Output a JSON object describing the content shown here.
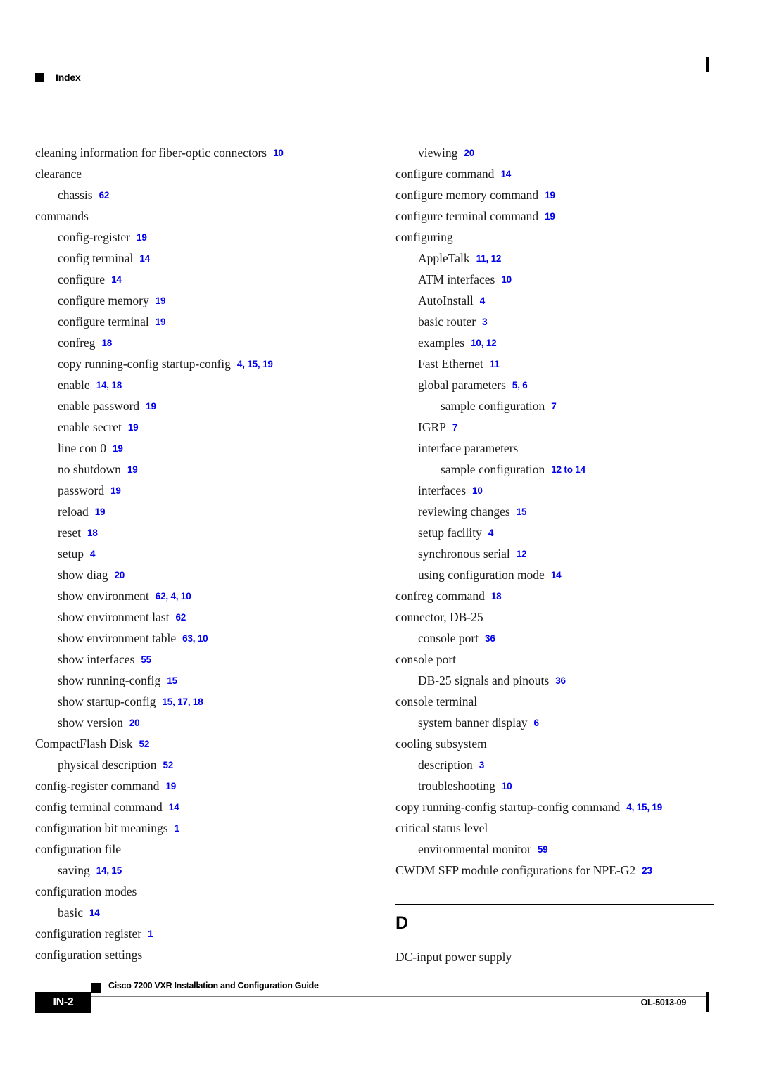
{
  "header": {
    "label": "Index",
    "marker_icon": "filled-square-icon"
  },
  "footer": {
    "page_number": "IN-2",
    "document_title": "Cisco 7200 VXR Installation and Configuration Guide",
    "document_id": "OL-5013-09",
    "marker_icon": "filled-square-icon"
  },
  "colors": {
    "page_number_link": "#0000ee",
    "text": "#1a1a1a",
    "rule": "#000000",
    "footer_rule": "#808080"
  },
  "columns": {
    "left": [
      {
        "level": 0,
        "term": "cleaning information for fiber-optic connectors",
        "pages": "10"
      },
      {
        "level": 0,
        "term": "clearance",
        "pages": ""
      },
      {
        "level": 1,
        "term": "chassis",
        "pages": "62"
      },
      {
        "level": 0,
        "term": "commands",
        "pages": ""
      },
      {
        "level": 1,
        "term": "config-register",
        "pages": "19"
      },
      {
        "level": 1,
        "term": "config terminal",
        "pages": "14"
      },
      {
        "level": 1,
        "term": "configure",
        "pages": "14"
      },
      {
        "level": 1,
        "term": "configure memory",
        "pages": "19"
      },
      {
        "level": 1,
        "term": "configure terminal",
        "pages": "19"
      },
      {
        "level": 1,
        "term": "confreg",
        "pages": "18"
      },
      {
        "level": 1,
        "term": "copy running-config startup-config",
        "pages": "4, 15, 19"
      },
      {
        "level": 1,
        "term": "enable",
        "pages": "14, 18"
      },
      {
        "level": 1,
        "term": "enable password",
        "pages": "19"
      },
      {
        "level": 1,
        "term": "enable secret",
        "pages": "19"
      },
      {
        "level": 1,
        "term": "line con 0",
        "pages": "19"
      },
      {
        "level": 1,
        "term": "no shutdown",
        "pages": "19"
      },
      {
        "level": 1,
        "term": "password",
        "pages": "19"
      },
      {
        "level": 1,
        "term": "reload",
        "pages": "19"
      },
      {
        "level": 1,
        "term": "reset",
        "pages": "18"
      },
      {
        "level": 1,
        "term": "setup",
        "pages": "4"
      },
      {
        "level": 1,
        "term": "show diag",
        "pages": "20"
      },
      {
        "level": 1,
        "term": "show environment",
        "pages": "62, 4, 10"
      },
      {
        "level": 1,
        "term": "show environment last",
        "pages": "62"
      },
      {
        "level": 1,
        "term": "show environment table",
        "pages": "63, 10"
      },
      {
        "level": 1,
        "term": "show interfaces",
        "pages": "55"
      },
      {
        "level": 1,
        "term": "show running-config",
        "pages": "15"
      },
      {
        "level": 1,
        "term": "show startup-config",
        "pages": "15, 17, 18"
      },
      {
        "level": 1,
        "term": "show version",
        "pages": "20"
      },
      {
        "level": 0,
        "term": "CompactFlash Disk",
        "pages": "52"
      },
      {
        "level": 1,
        "term": "physical description",
        "pages": "52"
      },
      {
        "level": 0,
        "term": "config-register command",
        "pages": "19"
      },
      {
        "level": 0,
        "term": "config terminal command",
        "pages": "14"
      },
      {
        "level": 0,
        "term": "configuration bit meanings",
        "pages": "1"
      },
      {
        "level": 0,
        "term": "configuration file",
        "pages": ""
      },
      {
        "level": 1,
        "term": "saving",
        "pages": "14, 15"
      },
      {
        "level": 0,
        "term": "configuration modes",
        "pages": ""
      },
      {
        "level": 1,
        "term": "basic",
        "pages": "14"
      },
      {
        "level": 0,
        "term": "configuration register",
        "pages": "1"
      },
      {
        "level": 0,
        "term": "configuration settings",
        "pages": ""
      }
    ],
    "right": [
      {
        "level": 1,
        "term": "viewing",
        "pages": "20"
      },
      {
        "level": 0,
        "term": "configure command",
        "pages": "14"
      },
      {
        "level": 0,
        "term": "configure memory command",
        "pages": "19"
      },
      {
        "level": 0,
        "term": "configure terminal command",
        "pages": "19"
      },
      {
        "level": 0,
        "term": "configuring",
        "pages": ""
      },
      {
        "level": 1,
        "term": "AppleTalk",
        "pages": "11, 12"
      },
      {
        "level": 1,
        "term": "ATM interfaces",
        "pages": "10"
      },
      {
        "level": 1,
        "term": "AutoInstall",
        "pages": "4"
      },
      {
        "level": 1,
        "term": "basic router",
        "pages": "3"
      },
      {
        "level": 1,
        "term": "examples",
        "pages": "10, 12"
      },
      {
        "level": 1,
        "term": "Fast Ethernet",
        "pages": "11"
      },
      {
        "level": 1,
        "term": "global parameters",
        "pages": "5, 6"
      },
      {
        "level": 2,
        "term": "sample configuration",
        "pages": "7"
      },
      {
        "level": 1,
        "term": "IGRP",
        "pages": "7"
      },
      {
        "level": 1,
        "term": "interface parameters",
        "pages": ""
      },
      {
        "level": 2,
        "term": "sample configuration",
        "pages": "12 to 14"
      },
      {
        "level": 1,
        "term": "interfaces",
        "pages": "10"
      },
      {
        "level": 1,
        "term": "reviewing changes",
        "pages": "15"
      },
      {
        "level": 1,
        "term": "setup facility",
        "pages": "4"
      },
      {
        "level": 1,
        "term": "synchronous serial",
        "pages": "12"
      },
      {
        "level": 1,
        "term": "using configuration mode",
        "pages": "14"
      },
      {
        "level": 0,
        "term": "confreg command",
        "pages": "18"
      },
      {
        "level": 0,
        "term": "connector, DB-25",
        "pages": ""
      },
      {
        "level": 1,
        "term": "console port",
        "pages": "36"
      },
      {
        "level": 0,
        "term": "console port",
        "pages": ""
      },
      {
        "level": 1,
        "term": "DB-25 signals and pinouts",
        "pages": "36"
      },
      {
        "level": 0,
        "term": "console terminal",
        "pages": ""
      },
      {
        "level": 1,
        "term": "system banner display",
        "pages": "6"
      },
      {
        "level": 0,
        "term": "cooling subsystem",
        "pages": ""
      },
      {
        "level": 1,
        "term": "description",
        "pages": "3"
      },
      {
        "level": 1,
        "term": "troubleshooting",
        "pages": "10"
      },
      {
        "level": 0,
        "term": "copy running-config startup-config command",
        "pages": "4, 15, 19"
      },
      {
        "level": 0,
        "term": "critical status level",
        "pages": ""
      },
      {
        "level": 1,
        "term": "environmental monitor",
        "pages": "59"
      },
      {
        "level": 0,
        "term": "CWDM SFP module configurations for NPE-G2",
        "pages": "23"
      },
      {
        "type": "section",
        "letter": "D"
      },
      {
        "level": 0,
        "term": "DC-input power supply",
        "pages": ""
      }
    ]
  }
}
